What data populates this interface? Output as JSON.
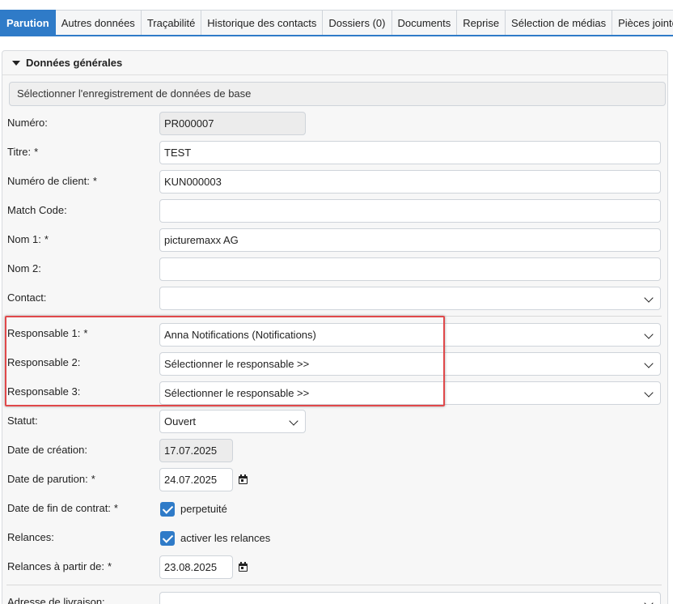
{
  "tabs": [
    {
      "label": "Parution"
    },
    {
      "label": "Autres données"
    },
    {
      "label": "Traçabilité"
    },
    {
      "label": "Historique des contacts"
    },
    {
      "label": "Dossiers (0)"
    },
    {
      "label": "Documents"
    },
    {
      "label": "Reprise"
    },
    {
      "label": "Sélection de médias"
    },
    {
      "label": "Pièces jointes"
    }
  ],
  "active_tab": "Parution",
  "section": {
    "title": "Données générales",
    "select_base_label": "Sélectionner l'enregistrement de données de base"
  },
  "fields": {
    "numero": {
      "label": "Numéro:",
      "value": "PR000007"
    },
    "titre": {
      "label": "Titre:",
      "required": "*",
      "value": "TEST"
    },
    "numero_client": {
      "label": "Numéro de client:",
      "required": "*",
      "value": "KUN000003"
    },
    "match_code": {
      "label": "Match Code:",
      "value": ""
    },
    "nom1": {
      "label": "Nom 1:",
      "required": "*",
      "value": "picturemaxx AG"
    },
    "nom2": {
      "label": "Nom 2:",
      "value": ""
    },
    "contact": {
      "label": "Contact:",
      "value": ""
    },
    "responsable1": {
      "label": "Responsable 1:",
      "required": "*",
      "value": "Anna Notifications (Notifications)"
    },
    "responsable2": {
      "label": "Responsable 2:",
      "value": "Sélectionner le responsable >>"
    },
    "responsable3": {
      "label": "Responsable 3:",
      "value": "Sélectionner le responsable >>"
    },
    "statut": {
      "label": "Statut:",
      "value": "Ouvert"
    },
    "date_creation": {
      "label": "Date de création:",
      "value": "17.07.2025"
    },
    "date_parution": {
      "label": "Date de parution:",
      "required": "*",
      "value": "24.07.2025"
    },
    "date_fin_contrat": {
      "label": "Date de fin de contrat:",
      "required": "*",
      "checkbox_label": "perpetuité",
      "checked": true
    },
    "relances": {
      "label": "Relances:",
      "checkbox_label": "activer les relances",
      "checked": true
    },
    "relances_partir": {
      "label": "Relances à partir de:",
      "required": "*",
      "value": "23.08.2025"
    },
    "adresse_livraison": {
      "label": "Adresse de livraison:",
      "value": ""
    }
  },
  "colors": {
    "accent": "#2f7bc8",
    "highlight": "#e0484a"
  },
  "icons": [
    "caret-down-icon",
    "chevron-down-icon",
    "calendar-icon",
    "checkbox-checked-icon"
  ]
}
